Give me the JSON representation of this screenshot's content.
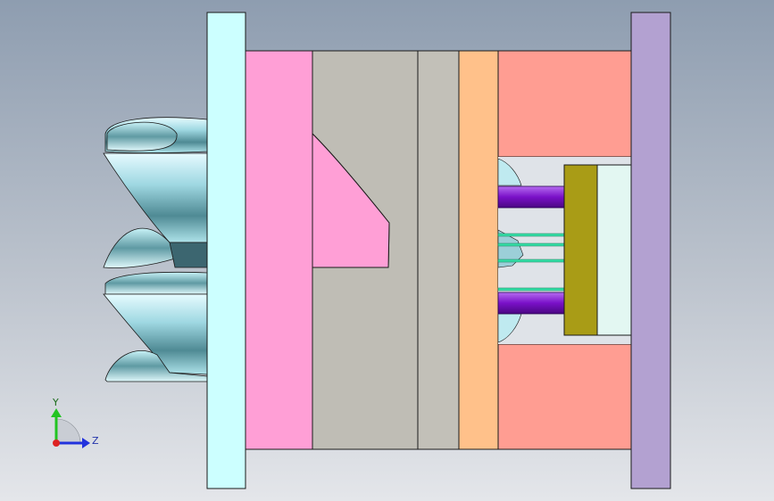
{
  "viewport": {
    "colors": {
      "bg_top": "#8e9db0",
      "bg_bottom": "#e4e6ea",
      "outline": "#1a1a1a"
    }
  },
  "model": {
    "components": [
      {
        "name": "left-clamp-plate",
        "color": "#ccffff"
      },
      {
        "name": "pink-cavity-plate",
        "color": "#ff9fd6"
      },
      {
        "name": "gray-core-insert",
        "color": "#bfbdb5"
      },
      {
        "name": "gray-core-back",
        "color": "#c2c0b8"
      },
      {
        "name": "orange-support-plate",
        "color": "#ffc18a"
      },
      {
        "name": "salmon-spacer-block-top",
        "color": "#ff9d92"
      },
      {
        "name": "salmon-spacer-block-bottom",
        "color": "#ff9d92"
      },
      {
        "name": "ejector-retainer-plate",
        "color": "#a99c16"
      },
      {
        "name": "ejector-plate",
        "color": "#e3f7f2"
      },
      {
        "name": "purple-ejector-pin",
        "color": "#8a18d6"
      },
      {
        "name": "green-return-pin",
        "color": "#36e0a8"
      },
      {
        "name": "right-clamp-plate",
        "color": "#b3a1d1"
      },
      {
        "name": "sprue-part",
        "color": "#b8eaf1"
      }
    ]
  },
  "triad": {
    "y_label": "Y",
    "z_label": "Z",
    "colors": {
      "y": "#22c422",
      "z": "#2233dd",
      "x": "#dd2222"
    }
  }
}
